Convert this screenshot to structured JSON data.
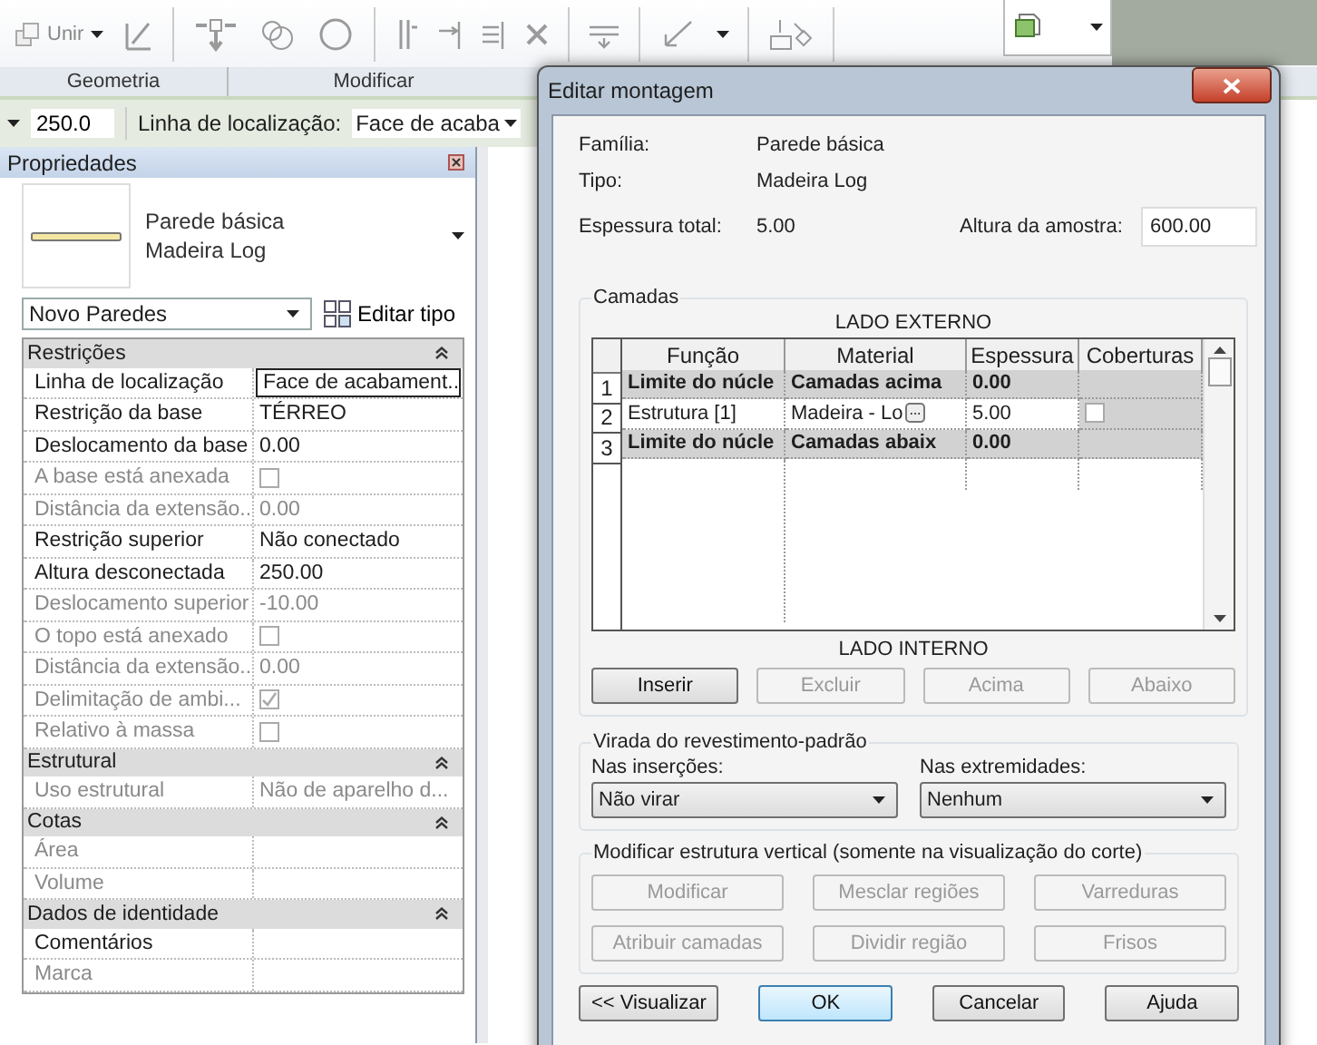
{
  "ribbon": {
    "join_button": {
      "label": "Unir"
    },
    "groups": [
      {
        "label": "Geometria"
      },
      {
        "label": "Modificar"
      }
    ]
  },
  "options_bar": {
    "value": "250.0",
    "location_label": "Linha de localização:",
    "location_value": "Face de acaba"
  },
  "properties": {
    "title": "Propriedades",
    "type_lines": [
      "Parede básica",
      "Madeira Log"
    ],
    "selector": "Novo Paredes",
    "edit_type": "Editar tipo",
    "sections": [
      {
        "title": "Restrições",
        "rows": [
          {
            "label": "Linha de localização",
            "kind": "text",
            "value": "Face de acabament...",
            "disabled": false,
            "focused": true
          },
          {
            "label": "Restrição da base",
            "kind": "text",
            "value": "TÉRREO",
            "disabled": false,
            "focused": false
          },
          {
            "label": "Deslocamento da base",
            "kind": "text",
            "value": "0.00",
            "disabled": false,
            "focused": false
          },
          {
            "label": "A base está anexada",
            "kind": "checkbox",
            "checked": false,
            "disabled": true,
            "focused": false
          },
          {
            "label": "Distância da extensão...",
            "kind": "text",
            "value": "0.00",
            "disabled": true,
            "focused": false
          },
          {
            "label": "Restrição superior",
            "kind": "text",
            "value": "Não conectado",
            "disabled": false,
            "focused": false
          },
          {
            "label": "Altura desconectada",
            "kind": "text",
            "value": "250.00",
            "disabled": false,
            "focused": false
          },
          {
            "label": "Deslocamento superior",
            "kind": "text",
            "value": "-10.00",
            "disabled": true,
            "focused": false
          },
          {
            "label": "O topo está anexado",
            "kind": "checkbox",
            "checked": false,
            "disabled": true,
            "focused": false
          },
          {
            "label": "Distância da extensão...",
            "kind": "text",
            "value": "0.00",
            "disabled": true,
            "focused": false
          },
          {
            "label": "Delimitação de ambi...",
            "kind": "checkbox",
            "checked": true,
            "disabled": true,
            "focused": false
          },
          {
            "label": "Relativo à massa",
            "kind": "checkbox",
            "checked": false,
            "disabled": true,
            "focused": false
          }
        ]
      },
      {
        "title": "Estrutural",
        "rows": [
          {
            "label": "Uso estrutural",
            "kind": "text",
            "value": "Não de aparelho d...",
            "disabled": true,
            "focused": false
          }
        ]
      },
      {
        "title": "Cotas",
        "rows": [
          {
            "label": "Área",
            "kind": "empty",
            "disabled": true,
            "focused": false
          },
          {
            "label": "Volume",
            "kind": "empty",
            "disabled": true,
            "focused": false
          }
        ]
      },
      {
        "title": "Dados de identidade",
        "rows": [
          {
            "label": "Comentários",
            "kind": "empty",
            "disabled": false,
            "focused": false
          },
          {
            "label": "Marca",
            "kind": "empty",
            "disabled": true,
            "focused": false
          }
        ]
      }
    ]
  },
  "dialog": {
    "title": "Editar montagem",
    "info": [
      {
        "label": "Família:",
        "value": "Parede básica"
      },
      {
        "label": "Tipo:",
        "value": "Madeira Log"
      },
      {
        "label": "Espessura total:",
        "value": "5.00"
      }
    ],
    "sample_height": {
      "label": "Altura da amostra:",
      "value": "600.00"
    },
    "layers": {
      "title": "Camadas",
      "exterior_label": "LADO EXTERNO",
      "interior_label": "LADO INTERNO",
      "columns": [
        "Função",
        "Material",
        "Espessura",
        "Coberturas"
      ],
      "rows": [
        {
          "number": "1",
          "kind": "boundary",
          "function": "Limite do núcle",
          "material": "Camadas acima",
          "thickness": "0.00"
        },
        {
          "number": "2",
          "kind": "layer",
          "function": "Estrutura [1]",
          "material": "Madeira - Lo",
          "thickness": "5.00",
          "wraps": false
        },
        {
          "number": "3",
          "kind": "boundary",
          "function": "Limite do núcle",
          "material": "Camadas abaix",
          "thickness": "0.00"
        }
      ],
      "buttons": [
        {
          "label": "Inserir",
          "disabled": false
        },
        {
          "label": "Excluir",
          "disabled": true
        },
        {
          "label": "Acima",
          "disabled": true
        },
        {
          "label": "Abaixo",
          "disabled": true
        }
      ]
    },
    "wrapping": {
      "title": "Virada do revestimento-padrão",
      "fields": [
        {
          "label": "Nas inserções:",
          "value": "Não virar"
        },
        {
          "label": "Nas extremidades:",
          "value": "Nenhum"
        }
      ]
    },
    "vertical": {
      "title": "Modificar estrutura vertical (somente na visualização do corte)",
      "buttons": [
        {
          "label": "Modificar",
          "disabled": true
        },
        {
          "label": "Mesclar regiões",
          "disabled": true
        },
        {
          "label": "Varreduras",
          "disabled": true
        },
        {
          "label": "Atribuir camadas",
          "disabled": true
        },
        {
          "label": "Dividir região",
          "disabled": true
        },
        {
          "label": "Frisos",
          "disabled": true
        }
      ]
    },
    "footer": [
      {
        "label": "<< Visualizar",
        "default": false
      },
      {
        "label": "OK",
        "default": true
      },
      {
        "label": "Cancelar",
        "default": false
      },
      {
        "label": "Ajuda",
        "default": false
      }
    ]
  }
}
